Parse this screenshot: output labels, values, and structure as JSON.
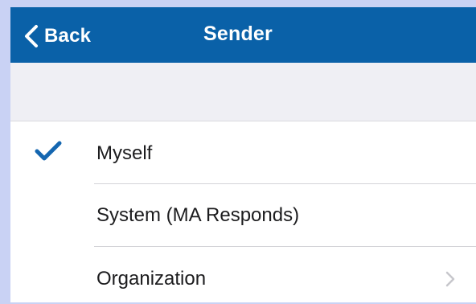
{
  "navbar": {
    "back_label": "Back",
    "title": "Sender",
    "background_color": "#0a61a8"
  },
  "options": [
    {
      "label": "Myself",
      "selected": true,
      "icon": "checkmark-icon"
    },
    {
      "label": "System (MA Responds)",
      "selected": false
    },
    {
      "label": "Organization",
      "selected": false,
      "icon": "chevron-right-icon"
    }
  ],
  "colors": {
    "accent": "#0a61a8",
    "check": "#1466b0",
    "chevron": "#c7c7cc",
    "background": "#c9d2f4"
  }
}
